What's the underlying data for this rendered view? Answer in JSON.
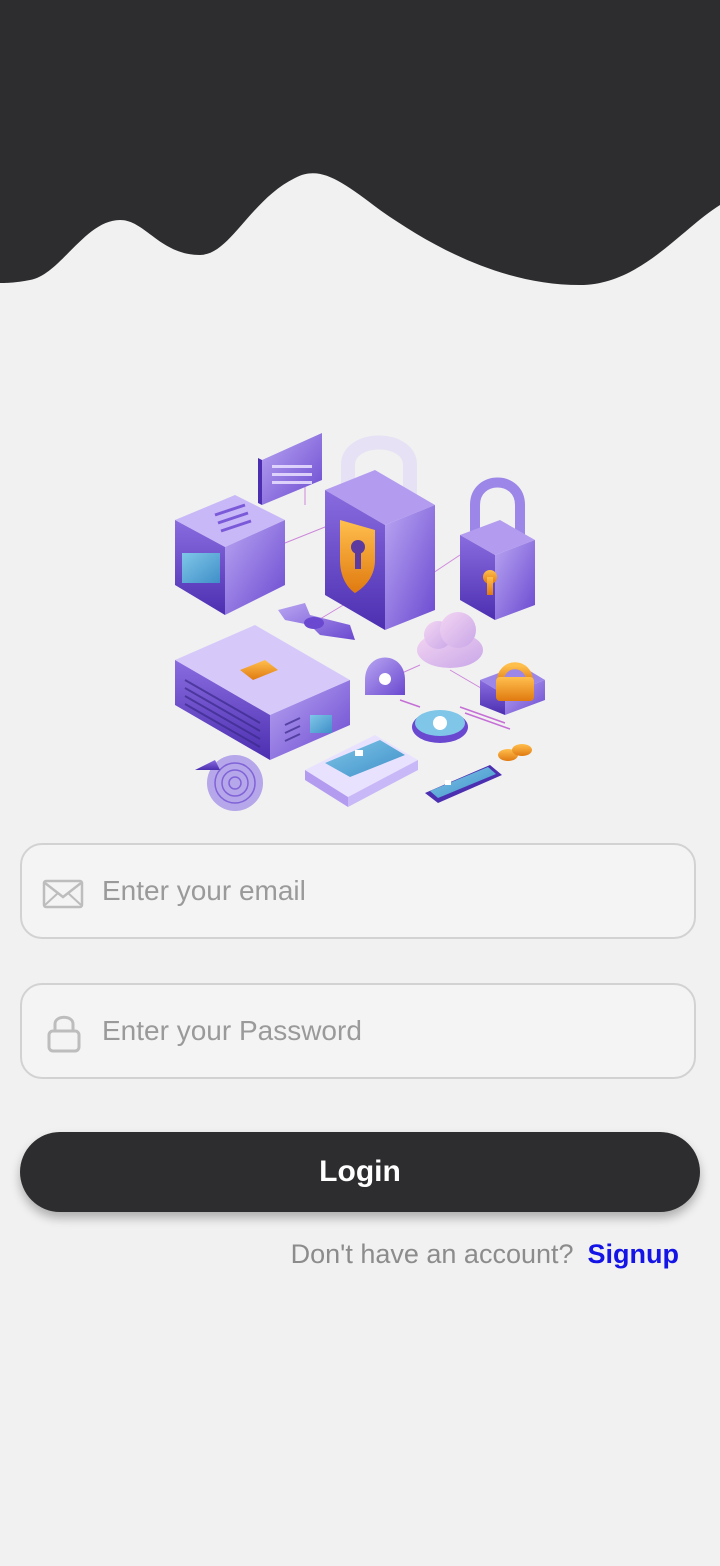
{
  "colors": {
    "header": "#2d2d2f",
    "background": "#f1f1f1",
    "button": "#2d2d2f",
    "link": "#1414e6",
    "accent_purple": "#7a5ad8",
    "accent_orange": "#f5a623"
  },
  "illustration": {
    "icon": "security-isometric-illustration"
  },
  "email_field": {
    "icon": "envelope-icon",
    "placeholder": "Enter your email",
    "value": ""
  },
  "password_field": {
    "icon": "lock-icon",
    "placeholder": "Enter your Password",
    "value": ""
  },
  "login_button": {
    "label": "Login"
  },
  "signup": {
    "prompt": "Don't have an account?",
    "link_label": "Signup"
  }
}
